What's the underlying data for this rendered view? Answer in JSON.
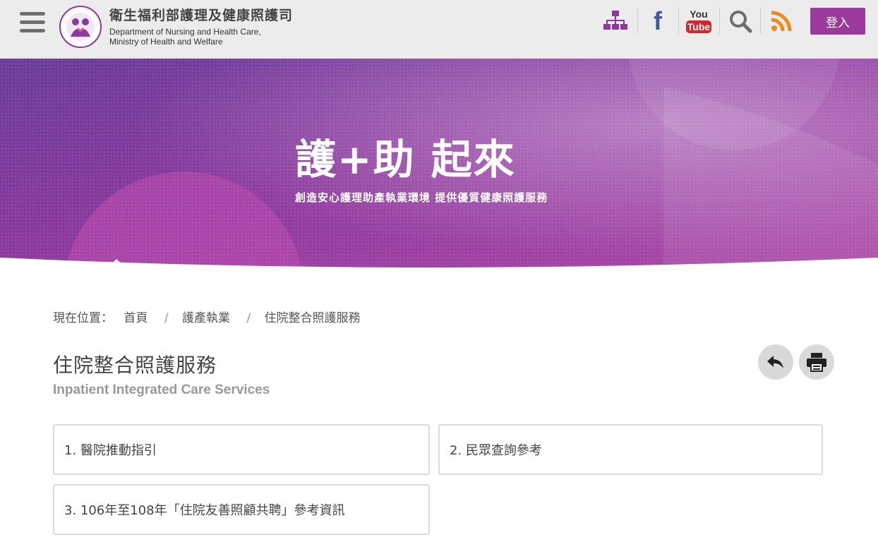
{
  "header": {
    "org_name_zh": "衛生福利部護理及健康照護司",
    "org_name_en_line1": "Department of Nursing and Health Care,",
    "org_name_en_line2": "Ministry of Health and Welfare",
    "login_label": "登入",
    "icons": [
      "sitemap-icon",
      "facebook-icon",
      "youtube-icon",
      "search-icon",
      "rss-icon"
    ],
    "youtube_text_top": "You",
    "youtube_text_bottom": "Tube",
    "facebook_glyph": "f"
  },
  "banner": {
    "title": "護+助 起來",
    "subtitle": "創造安心護理助產執業環境 提供優質健康照護服務"
  },
  "breadcrumb": {
    "label": "現在位置：",
    "items": [
      "首頁",
      "護產執業",
      "住院整合照護服務"
    ],
    "separator": "/"
  },
  "page": {
    "title": "住院整合照護服務",
    "subtitle": "Inpatient Integrated Care Services"
  },
  "cards": [
    "1.  醫院推動指引",
    "2.  民眾查詢參考",
    "3.  106年至108年「住院友善照顧共聘」參考資訊"
  ],
  "colors": {
    "accent": "#9b3a9c",
    "header_bg": "#ececec",
    "sitemap": "#8a3a9a",
    "facebook": "#3b5a98",
    "youtube": "#d9252a",
    "rss": "#f08a1c"
  }
}
